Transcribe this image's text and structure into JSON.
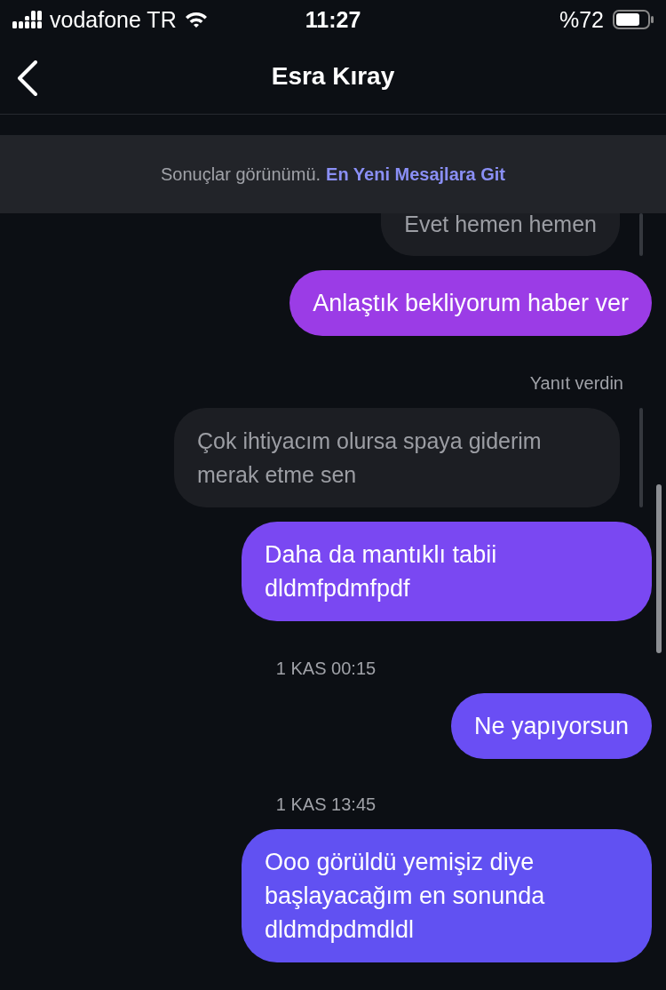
{
  "status_bar": {
    "carrier": "vodafone TR",
    "time": "11:27",
    "battery": "%72"
  },
  "header": {
    "title": "Esra Kıray"
  },
  "banner": {
    "text": "Sonuçlar görünümü.",
    "link": "En Yeni Mesajlara Git"
  },
  "messages": [
    {
      "kind": "quote",
      "text": "Evet hemen hemen"
    },
    {
      "kind": "sent",
      "text": "Anlaştık bekliyorum haber ver",
      "color": "#9b3ce6"
    },
    {
      "kind": "note",
      "text": "Yanıt verdin"
    },
    {
      "kind": "quote",
      "text": "Çok ihtiyacım olursa spaya giderim merak etme sen"
    },
    {
      "kind": "sent",
      "text": "Daha da mantıklı tabii dldmfpdmfpdf",
      "color": "#7a48f2"
    },
    {
      "kind": "time",
      "text": "1 KAS 00:15"
    },
    {
      "kind": "sent",
      "text": "Ne yapıyorsun",
      "color": "#6a4ef4"
    },
    {
      "kind": "time",
      "text": "1 KAS 13:45"
    },
    {
      "kind": "sent",
      "text": "Ooo görüldü yemişiz diye başlayacağım en sonunda dldmdpdmdldl",
      "color": "#6151f2"
    }
  ]
}
